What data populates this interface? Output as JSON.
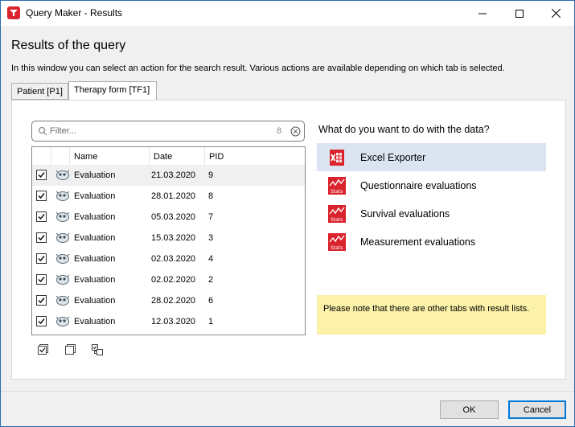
{
  "window": {
    "title": "Query Maker - Results"
  },
  "header": {
    "heading": "Results of the query",
    "info": "In this window you can select an action for the search result. Various actions are available depending on which tab is selected."
  },
  "tabs": [
    {
      "label": "Patient [P1]",
      "active": false
    },
    {
      "label": "Therapy form [TF1]",
      "active": true
    }
  ],
  "filter": {
    "placeholder": "Filter...",
    "count": "8"
  },
  "grid": {
    "columns": [
      "Name",
      "Date",
      "PID"
    ],
    "rows": [
      {
        "checked": true,
        "name": "Evaluation",
        "date": "21.03.2020",
        "pid": "9"
      },
      {
        "checked": true,
        "name": "Evaluation",
        "date": "28.01.2020",
        "pid": "8"
      },
      {
        "checked": true,
        "name": "Evaluation",
        "date": "05.03.2020",
        "pid": "7"
      },
      {
        "checked": true,
        "name": "Evaluation",
        "date": "15.03.2020",
        "pid": "3"
      },
      {
        "checked": true,
        "name": "Evaluation",
        "date": "02.03.2020",
        "pid": "4"
      },
      {
        "checked": true,
        "name": "Evaluation",
        "date": "02.02.2020",
        "pid": "2"
      },
      {
        "checked": true,
        "name": "Evaluation",
        "date": "28.02.2020",
        "pid": "6"
      },
      {
        "checked": true,
        "name": "Evaluation",
        "date": "12.03.2020",
        "pid": "1"
      }
    ]
  },
  "actions": {
    "question": "What do you want to do with the data?",
    "items": [
      {
        "label": "Excel Exporter",
        "icon": "excel-icon",
        "selected": true
      },
      {
        "label": "Questionnaire evaluations",
        "icon": "stats-icon",
        "selected": false
      },
      {
        "label": "Survival evaluations",
        "icon": "stats-icon",
        "selected": false
      },
      {
        "label": "Measurement evaluations",
        "icon": "stats-icon",
        "selected": false
      }
    ],
    "stats_icon_text": "Stats"
  },
  "notice": "Please note that there are other tabs with result lists.",
  "buttons": {
    "ok": "OK",
    "cancel": "Cancel"
  },
  "colors": {
    "accent": "#0078d7",
    "brand_red": "#d9232d",
    "selection": "#dbe5f2",
    "notice_bg": "#fbf1a9"
  }
}
